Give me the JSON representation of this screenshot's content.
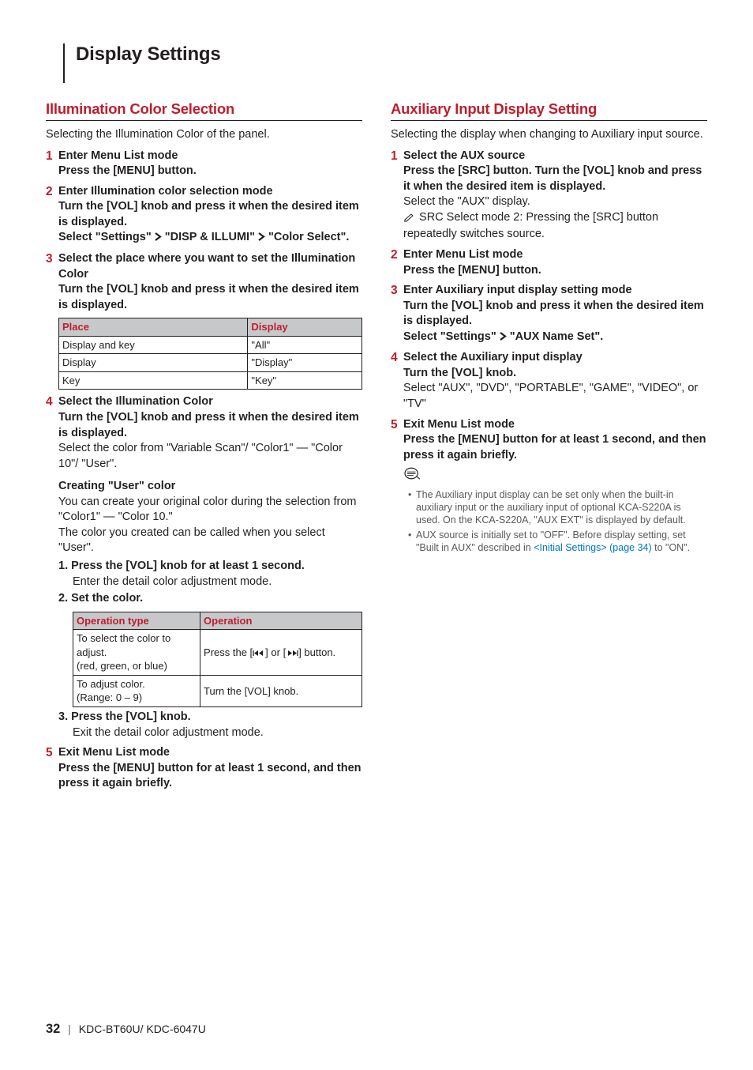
{
  "page_title": "Display Settings",
  "left": {
    "heading": "Illumination Color Selection",
    "intro": "Selecting the Illumination Color of the panel.",
    "step1": {
      "title": "Enter Menu List mode",
      "line1": "Press the [MENU] button."
    },
    "step2": {
      "title": "Enter Illumination color selection mode",
      "line1": "Turn the [VOL] knob and press it when the desired item is displayed.",
      "line2a": "Select \"Settings\"",
      "line2b": "\"DISP & ILLUMI\"",
      "line2c": "\"Color Select\"."
    },
    "step3": {
      "title": "Select the place where you want to set the Illumination Color",
      "line1": "Turn the [VOL] knob and press it when the desired item is displayed."
    },
    "table1": {
      "h1": "Place",
      "h2": "Display",
      "rows": [
        [
          "Display and key",
          "\"All\""
        ],
        [
          "Display",
          "\"Display\""
        ],
        [
          "Key",
          "\"Key\""
        ]
      ]
    },
    "step4": {
      "title": "Select the Illumination Color",
      "line1": "Turn the [VOL] knob and press it when the desired item is displayed.",
      "line2": "Select the color from \"Variable Scan\"/ \"Color1\" — \"Color 10\"/ \"User\".",
      "user_head": "Creating \"User\" color",
      "user1": "You can create your original color during the selection from \"Color1\" — \"Color 10.\"",
      "user2": "The color you created can be called when you select \"User\".",
      "s1a": "1. Press the [VOL] knob for at least 1 second.",
      "s1b": "Enter the detail color adjustment mode.",
      "s2a": "2. Set the color."
    },
    "table2": {
      "h1": "Operation type",
      "h2": "Operation",
      "rows": [
        {
          "c1a": "To select the color to adjust.",
          "c1b": "(red, green, or blue)",
          "c2a": "Press the [",
          "c2b": "] or [",
          "c2c": "] button."
        },
        {
          "c1a": "To adjust color.",
          "c1b": "(Range: 0 – 9)",
          "c2": "Turn the [VOL] knob."
        }
      ]
    },
    "step4b": {
      "s3a": "3. Press the [VOL] knob.",
      "s3b": "Exit the detail color adjustment mode."
    },
    "step5": {
      "title": "Exit Menu List mode",
      "line1": "Press the [MENU] button for at least 1 second, and then press it again briefly."
    }
  },
  "right": {
    "heading": "Auxiliary Input Display Setting",
    "intro": "Selecting the display when changing to Auxiliary input source.",
    "step1": {
      "title": "Select the AUX source",
      "line1": "Press the [SRC] button. Turn the [VOL] knob and press it when the desired item is displayed.",
      "line2": "Select the \"AUX\" display.",
      "note": "SRC Select mode 2: Pressing the [SRC] button repeatedly switches source."
    },
    "step2": {
      "title": "Enter Menu List mode",
      "line1": "Press the [MENU] button."
    },
    "step3": {
      "title": "Enter Auxiliary input display setting mode",
      "line1": "Turn the [VOL] knob and press it when the desired item is displayed.",
      "line2a": "Select \"Settings\"",
      "line2b": "\"AUX Name Set\"."
    },
    "step4": {
      "title": "Select the Auxiliary input display",
      "line1": "Turn the [VOL] knob.",
      "line2": "Select \"AUX\", \"DVD\", \"PORTABLE\", \"GAME\", \"VIDEO\", or \"TV\""
    },
    "step5": {
      "title": "Exit Menu List mode",
      "line1": "Press the [MENU] button for at least 1 second, and then press it again briefly."
    },
    "notes": {
      "n1": "The Auxiliary input display can be set only when the built-in auxiliary input or the auxiliary input of optional KCA-S220A is used. On the KCA-S220A, \"AUX EXT\" is displayed by default.",
      "n2a": "AUX source is initially set to \"OFF\". Before display setting, set \"Built in AUX\" described in ",
      "n2link": "<Initial Settings> (page 34)",
      "n2b": " to \"ON\"."
    }
  },
  "footer": {
    "page": "32",
    "model": "KDC-BT60U/ KDC-6047U"
  }
}
